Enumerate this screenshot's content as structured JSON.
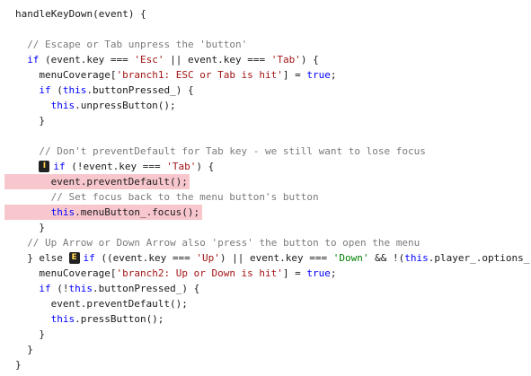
{
  "lines": [
    {
      "indent": 0,
      "uncovered": false,
      "tokens": [
        {
          "t": "handleKeyDown(event) {",
          "c": "ok"
        }
      ]
    },
    {
      "indent": 0,
      "uncovered": false,
      "tokens": []
    },
    {
      "indent": 1,
      "uncovered": false,
      "tokens": [
        {
          "t": "// Escape or Tab unpress the 'button'",
          "c": "comment"
        }
      ]
    },
    {
      "indent": 1,
      "uncovered": false,
      "tokens": [
        {
          "t": "if",
          "c": "kw"
        },
        {
          "t": " (event.key === ",
          "c": "ok"
        },
        {
          "t": "'Esc'",
          "c": "str"
        },
        {
          "t": " || event.key === ",
          "c": "ok"
        },
        {
          "t": "'Tab'",
          "c": "str"
        },
        {
          "t": ") {",
          "c": "ok"
        }
      ]
    },
    {
      "indent": 2,
      "uncovered": false,
      "tokens": [
        {
          "t": "menuCoverage[",
          "c": "ok"
        },
        {
          "t": "'branch1: ESC or Tab is hit'",
          "c": "str"
        },
        {
          "t": "] = ",
          "c": "ok"
        },
        {
          "t": "true",
          "c": "kw"
        },
        {
          "t": ";",
          "c": "ok"
        }
      ]
    },
    {
      "indent": 2,
      "uncovered": false,
      "tokens": [
        {
          "t": "if",
          "c": "kw"
        },
        {
          "t": " (",
          "c": "ok"
        },
        {
          "t": "this",
          "c": "kw"
        },
        {
          "t": ".buttonPressed_) {",
          "c": "ok"
        }
      ]
    },
    {
      "indent": 3,
      "uncovered": false,
      "tokens": [
        {
          "t": "this",
          "c": "kw"
        },
        {
          "t": ".unpressButton();",
          "c": "ok"
        }
      ]
    },
    {
      "indent": 2,
      "uncovered": false,
      "tokens": [
        {
          "t": "}",
          "c": "ok"
        }
      ]
    },
    {
      "indent": 0,
      "uncovered": false,
      "tokens": []
    },
    {
      "indent": 2,
      "uncovered": false,
      "tokens": [
        {
          "t": "// Don't preventDefault for Tab key - we still want to lose focus",
          "c": "comment"
        }
      ]
    },
    {
      "indent": 2,
      "uncovered": false,
      "badge": "I",
      "tokens": [
        {
          "t": "if",
          "c": "kw"
        },
        {
          "t": " (!event.key === ",
          "c": "ok"
        },
        {
          "t": "'Tab'",
          "c": "str"
        },
        {
          "t": ") {",
          "c": "ok"
        }
      ]
    },
    {
      "indent": 3,
      "uncovered": true,
      "tokens": [
        {
          "t": "event.preventDefault();",
          "c": "ok"
        }
      ]
    },
    {
      "indent": 3,
      "uncovered": false,
      "tokens": [
        {
          "t": "// Set focus back to the menu button's button",
          "c": "comment"
        }
      ]
    },
    {
      "indent": 3,
      "uncovered": true,
      "tokens": [
        {
          "t": "this",
          "c": "kw"
        },
        {
          "t": ".menuButton_.focus();",
          "c": "ok"
        }
      ]
    },
    {
      "indent": 2,
      "uncovered": false,
      "tokens": [
        {
          "t": "}",
          "c": "ok"
        }
      ]
    },
    {
      "indent": 1,
      "uncovered": false,
      "tokens": [
        {
          "t": "// Up Arrow or Down Arrow also 'press' the button to open the menu",
          "c": "comment"
        }
      ]
    },
    {
      "indent": 1,
      "uncovered": false,
      "badge": "E",
      "badgeAfter": "} else ",
      "tokens": [
        {
          "t": "if",
          "c": "kw"
        },
        {
          "t": " ((event.key === ",
          "c": "ok"
        },
        {
          "t": "'Up'",
          "c": "str"
        },
        {
          "t": ") || event.key === ",
          "c": "ok"
        },
        {
          "t": "'Down'",
          "c": "str2"
        },
        {
          "t": " && !(",
          "c": "ok"
        },
        {
          "t": "this",
          "c": "kw"
        },
        {
          "t": ".player_.options_",
          "c": "ok"
        }
      ]
    },
    {
      "indent": 2,
      "uncovered": false,
      "tokens": [
        {
          "t": "menuCoverage[",
          "c": "ok"
        },
        {
          "t": "'branch2: Up or Down is hit'",
          "c": "str"
        },
        {
          "t": "] = ",
          "c": "ok"
        },
        {
          "t": "true",
          "c": "kw"
        },
        {
          "t": ";",
          "c": "ok"
        }
      ]
    },
    {
      "indent": 2,
      "uncovered": false,
      "tokens": [
        {
          "t": "if",
          "c": "kw"
        },
        {
          "t": " (!",
          "c": "ok"
        },
        {
          "t": "this",
          "c": "kw"
        },
        {
          "t": ".buttonPressed_) {",
          "c": "ok"
        }
      ]
    },
    {
      "indent": 3,
      "uncovered": false,
      "tokens": [
        {
          "t": "event.preventDefault();",
          "c": "ok"
        }
      ]
    },
    {
      "indent": 3,
      "uncovered": false,
      "tokens": [
        {
          "t": "this",
          "c": "kw"
        },
        {
          "t": ".pressButton();",
          "c": "ok"
        }
      ]
    },
    {
      "indent": 2,
      "uncovered": false,
      "tokens": [
        {
          "t": "}",
          "c": "ok"
        }
      ]
    },
    {
      "indent": 1,
      "uncovered": false,
      "tokens": [
        {
          "t": "}",
          "c": "ok"
        }
      ]
    },
    {
      "indent": 0,
      "uncovered": false,
      "tokens": [
        {
          "t": "}",
          "c": "ok"
        }
      ]
    }
  ],
  "colors": {
    "uncovered_highlight": "#f8c7ce",
    "badge_bg": "#222222",
    "badge_fg": "#ffd54f"
  }
}
